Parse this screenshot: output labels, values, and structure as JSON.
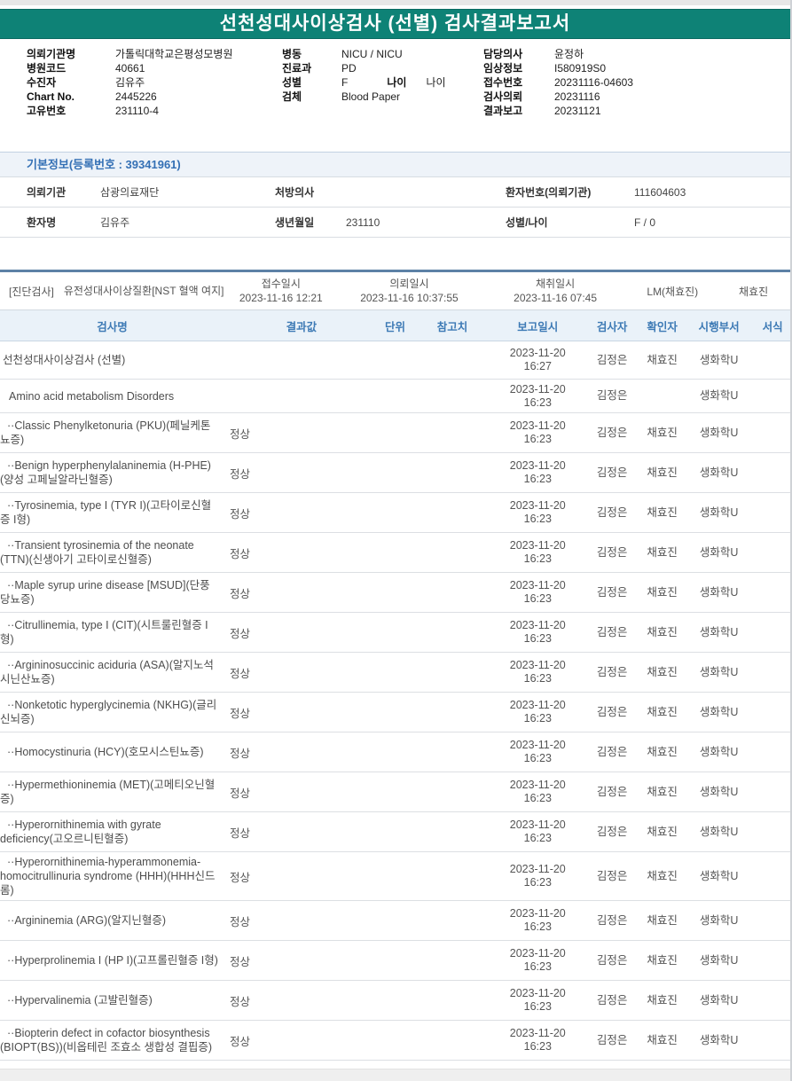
{
  "title": "선천성대사이상검사 (선별) 검사결과보고서",
  "report_header": {
    "left": [
      {
        "label": "의뢰기관명",
        "value": "가톨릭대학교은평성모병원"
      },
      {
        "label": "병원코드",
        "value": "40661"
      },
      {
        "label": "수진자",
        "value": "김유주"
      },
      {
        "label": "Chart No.",
        "value": "2445226"
      },
      {
        "label": "고유번호",
        "value": "231110-4"
      }
    ],
    "middle": [
      {
        "label": "병동",
        "value": "NICU / NICU"
      },
      {
        "label": "진료과",
        "value": "PD"
      },
      {
        "label": "성별",
        "value": "F",
        "extra_label": "나이",
        "extra_value": "나이"
      },
      {
        "label": "검체",
        "value": "Blood Paper"
      }
    ],
    "right": [
      {
        "label": "담당의사",
        "value": "윤정하"
      },
      {
        "label": "임상정보",
        "value": "I580919S0"
      },
      {
        "label": "접수번호",
        "value": "20231116-04603"
      },
      {
        "label": "검사의뢰",
        "value": "20231116"
      },
      {
        "label": "결과보고",
        "value": "20231121"
      }
    ]
  },
  "basic_info": {
    "section_title": "기본정보(등록번호 : 39341961)",
    "rows": [
      [
        {
          "label": "의뢰기관",
          "value": "삼광의료재단"
        },
        {
          "label": "처방의사",
          "value": ""
        },
        {
          "label": "환자번호(의뢰기관)",
          "value": "111604603"
        }
      ],
      [
        {
          "label": "환자명",
          "value": "김유주"
        },
        {
          "label": "생년월일",
          "value": "231110"
        },
        {
          "label": "성별/나이",
          "value": "F / 0"
        }
      ]
    ]
  },
  "diagnosis_strip": {
    "category": "[진단검사]",
    "specimen": "유전성대사이상질환[NST 혈액 여지]",
    "received_label": "접수일시",
    "received": "2023-11-16 12:21",
    "requested_label": "의뢰일시",
    "requested": "2023-11-16 10:37:55",
    "collected_label": "채취일시",
    "collected": "2023-11-16 07:45",
    "lab": "LM(채효진)",
    "collector": "채효진"
  },
  "results_table": {
    "headers": [
      "검사명",
      "결과값",
      "단위",
      "참고치",
      "보고일시",
      "검사자",
      "확인자",
      "시행부서",
      "서식"
    ],
    "rows": [
      {
        "name": "선천성대사이상검사 (선별)",
        "level": 0,
        "result": "",
        "unit": "",
        "reference": "",
        "reported": "2023-11-20 16:27",
        "tester": "김정은",
        "verifier": "채효진",
        "dept": "생화학U",
        "form": ""
      },
      {
        "name": "Amino acid metabolism Disorders",
        "level": 1,
        "result": "",
        "unit": "",
        "reference": "",
        "reported": "2023-11-20 16:23",
        "tester": "김정은",
        "verifier": "",
        "dept": "생화학U",
        "form": ""
      },
      {
        "name": "··Classic Phenylketonuria (PKU)(페닐케톤뇨증)",
        "level": 2,
        "result": "정상",
        "unit": "",
        "reference": "",
        "reported": "2023-11-20 16:23",
        "tester": "김정은",
        "verifier": "채효진",
        "dept": "생화학U",
        "form": ""
      },
      {
        "name": "··Benign hyperphenylalaninemia (H-PHE)(양성 고페닐알라닌혈증)",
        "level": 2,
        "result": "정상",
        "unit": "",
        "reference": "",
        "reported": "2023-11-20 16:23",
        "tester": "김정은",
        "verifier": "채효진",
        "dept": "생화학U",
        "form": ""
      },
      {
        "name": "··Tyrosinemia, type I (TYR I)(고타이로신혈증 I형)",
        "level": 2,
        "result": "정상",
        "unit": "",
        "reference": "",
        "reported": "2023-11-20 16:23",
        "tester": "김정은",
        "verifier": "채효진",
        "dept": "생화학U",
        "form": ""
      },
      {
        "name": "··Transient tyrosinemia of the neonate (TTN)(신생아기 고타이로신혈증)",
        "level": 2,
        "result": "정상",
        "unit": "",
        "reference": "",
        "reported": "2023-11-20 16:23",
        "tester": "김정은",
        "verifier": "채효진",
        "dept": "생화학U",
        "form": ""
      },
      {
        "name": "··Maple syrup urine disease [MSUD](단풍당뇨증)",
        "level": 2,
        "result": "정상",
        "unit": "",
        "reference": "",
        "reported": "2023-11-20 16:23",
        "tester": "김정은",
        "verifier": "채효진",
        "dept": "생화학U",
        "form": ""
      },
      {
        "name": "··Citrullinemia, type I (CIT)(시트룰린혈증 I형)",
        "level": 2,
        "result": "정상",
        "unit": "",
        "reference": "",
        "reported": "2023-11-20 16:23",
        "tester": "김정은",
        "verifier": "채효진",
        "dept": "생화학U",
        "form": ""
      },
      {
        "name": "··Argininosuccinic aciduria (ASA)(알지노석시닌산뇨증)",
        "level": 2,
        "result": "정상",
        "unit": "",
        "reference": "",
        "reported": "2023-11-20 16:23",
        "tester": "김정은",
        "verifier": "채효진",
        "dept": "생화학U",
        "form": ""
      },
      {
        "name": "··Nonketotic hyperglycinemia (NKHG)(글리신뇌증)",
        "level": 2,
        "result": "정상",
        "unit": "",
        "reference": "",
        "reported": "2023-11-20 16:23",
        "tester": "김정은",
        "verifier": "채효진",
        "dept": "생화학U",
        "form": ""
      },
      {
        "name": "··Homocystinuria (HCY)(호모시스틴뇨증)",
        "level": 2,
        "result": "정상",
        "unit": "",
        "reference": "",
        "reported": "2023-11-20 16:23",
        "tester": "김정은",
        "verifier": "채효진",
        "dept": "생화학U",
        "form": ""
      },
      {
        "name": "··Hypermethioninemia (MET)(고메티오닌혈증)",
        "level": 2,
        "result": "정상",
        "unit": "",
        "reference": "",
        "reported": "2023-11-20 16:23",
        "tester": "김정은",
        "verifier": "채효진",
        "dept": "생화학U",
        "form": ""
      },
      {
        "name": "··Hyperornithinemia with gyrate deficiency(고오르니틴혈증)",
        "level": 2,
        "result": "정상",
        "unit": "",
        "reference": "",
        "reported": "2023-11-20 16:23",
        "tester": "김정은",
        "verifier": "채효진",
        "dept": "생화학U",
        "form": ""
      },
      {
        "name": "··Hyperornithinemia-hyperammonemia-homocitrullinuria syndrome (HHH)(HHH신드롬)",
        "level": 2,
        "result": "정상",
        "unit": "",
        "reference": "",
        "reported": "2023-11-20 16:23",
        "tester": "김정은",
        "verifier": "채효진",
        "dept": "생화학U",
        "form": ""
      },
      {
        "name": "··Argininemia (ARG)(알지닌혈증)",
        "level": 2,
        "result": "정상",
        "unit": "",
        "reference": "",
        "reported": "2023-11-20 16:23",
        "tester": "김정은",
        "verifier": "채효진",
        "dept": "생화학U",
        "form": ""
      },
      {
        "name": "··Hyperprolinemia I (HP I)(고프롤린혈증 I형)",
        "level": 2,
        "result": "정상",
        "unit": "",
        "reference": "",
        "reported": "2023-11-20 16:23",
        "tester": "김정은",
        "verifier": "채효진",
        "dept": "생화학U",
        "form": ""
      },
      {
        "name": "··Hypervalinemia (고발린혈증)",
        "level": 2,
        "result": "정상",
        "unit": "",
        "reference": "",
        "reported": "2023-11-20 16:23",
        "tester": "김정은",
        "verifier": "채효진",
        "dept": "생화학U",
        "form": ""
      },
      {
        "name": "··Biopterin defect in cofactor biosynthesis (BIOPT(BS))(비옵테린 조효소 생합성 결핍증)",
        "level": 2,
        "result": "정상",
        "unit": "",
        "reference": "",
        "reported": "2023-11-20 16:23",
        "tester": "김정은",
        "verifier": "채효진",
        "dept": "생화학U",
        "form": ""
      }
    ]
  }
}
